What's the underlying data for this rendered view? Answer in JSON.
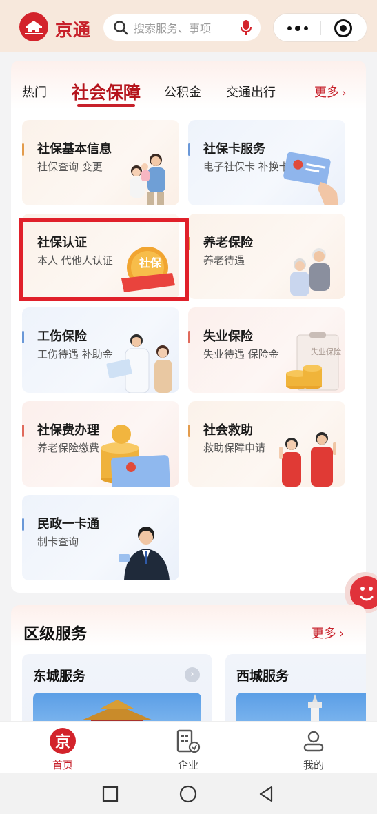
{
  "header": {
    "app_name": "京通",
    "logo_text": "京通",
    "search_placeholder": "搜索服务、事项"
  },
  "tabs": {
    "items": [
      {
        "label": "热门",
        "active": false
      },
      {
        "label": "社会保障",
        "active": true
      },
      {
        "label": "公积金",
        "active": false
      },
      {
        "label": "交通出行",
        "active": false
      }
    ],
    "more_label": "更多"
  },
  "services": [
    {
      "title": "社保基本信息",
      "subtitle": "社保查询 变更"
    },
    {
      "title": "社保卡服务",
      "subtitle": "电子社保卡 补换卡"
    },
    {
      "title": "社保认证",
      "subtitle": "本人 代他人认证",
      "badge": "社保"
    },
    {
      "title": "养老保险",
      "subtitle": "养老待遇"
    },
    {
      "title": "工伤保险",
      "subtitle": "工伤待遇 补助金"
    },
    {
      "title": "失业保险",
      "subtitle": "失业待遇 保险金",
      "badge": "失业保险"
    },
    {
      "title": "社保费办理",
      "subtitle": "养老保险缴费"
    },
    {
      "title": "社会救助",
      "subtitle": "救助保障申请"
    },
    {
      "title": "民政一卡通",
      "subtitle": "制卡查询"
    }
  ],
  "district": {
    "title": "区级服务",
    "more_label": "更多",
    "cards": [
      {
        "title": "东城服务"
      },
      {
        "title": "西城服务"
      }
    ]
  },
  "tabbar": {
    "items": [
      {
        "label": "首页",
        "active": true
      },
      {
        "label": "企业",
        "active": false
      },
      {
        "label": "我的",
        "active": false
      }
    ],
    "home_icon_glyph": "京"
  },
  "colors": {
    "brand_red": "#c7202a",
    "header_bg": "#f7e8dc"
  }
}
